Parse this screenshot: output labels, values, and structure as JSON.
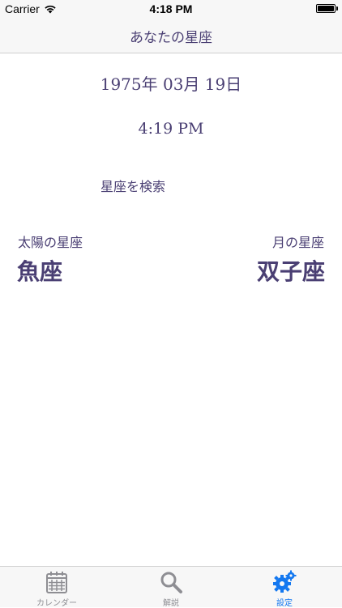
{
  "status_bar": {
    "carrier": "Carrier",
    "time": "4:18 PM",
    "icons": [
      "wifi-icon",
      "battery-icon"
    ]
  },
  "nav": {
    "title": "あなたの星座"
  },
  "main": {
    "date": "1975年 03月 19日",
    "time": "4:19 PM",
    "search_button": "星座を検索",
    "sun_sign": {
      "label": "太陽の星座",
      "value": "魚座"
    },
    "moon_sign": {
      "label": "月の星座",
      "value": "双子座"
    }
  },
  "tab_bar": {
    "tabs": [
      {
        "label": "カレンダー",
        "icon": "calendar-icon",
        "active": false
      },
      {
        "label": "解説",
        "icon": "magnifier-icon",
        "active": false
      },
      {
        "label": "設定",
        "icon": "gear-icon",
        "active": true
      }
    ]
  },
  "colors": {
    "text_primary": "#4a3f73",
    "tab_active": "#1478f0",
    "tab_inactive": "#8e8e93",
    "bar_background": "#f7f7f7"
  }
}
